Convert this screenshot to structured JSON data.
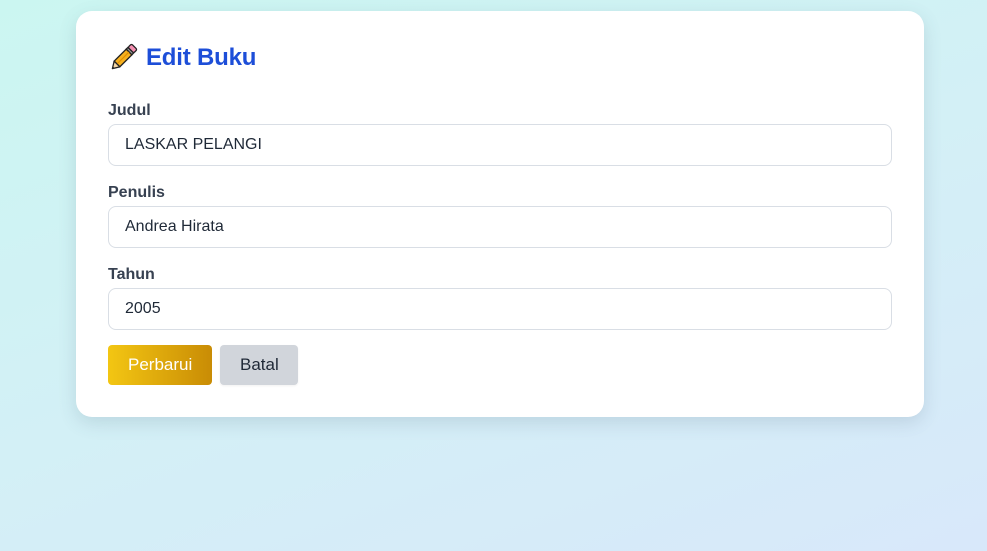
{
  "form": {
    "title": "Edit Buku",
    "title_icon": "pencil-icon",
    "fields": [
      {
        "label": "Judul",
        "value": "LASKAR PELANGI"
      },
      {
        "label": "Penulis",
        "value": "Andrea Hirata"
      },
      {
        "label": "Tahun",
        "value": "2005"
      }
    ],
    "buttons": {
      "submit_label": "Perbarui",
      "cancel_label": "Batal"
    }
  },
  "colors": {
    "title": "#1d4ed8",
    "primary_button_start": "#f3c613",
    "primary_button_end": "#c98c05",
    "secondary_button": "#d1d5db"
  }
}
